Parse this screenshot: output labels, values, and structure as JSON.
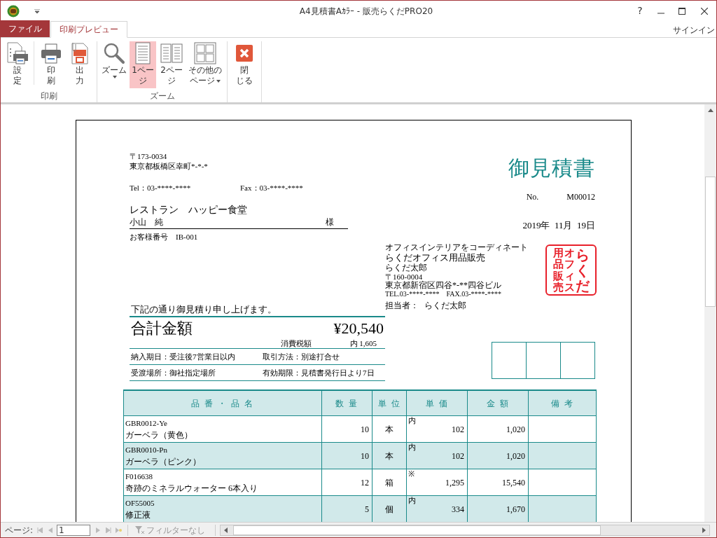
{
  "window": {
    "title": "A4見積書Aｶﾗｰ - 販売らくだPRO20",
    "help": "?"
  },
  "ribbon": {
    "file_menu": "ファイル",
    "tabs": [
      {
        "label": "印刷プレビュー",
        "selected": true
      }
    ],
    "account": "サインイン",
    "groups": [
      {
        "label": "印刷",
        "buttons": [
          {
            "kind": "setup",
            "lines": [
              "設",
              "定"
            ],
            "dropdown": false,
            "selected": false
          },
          {
            "kind": "printer",
            "lines": [
              "印",
              "刷"
            ],
            "dropdown": false,
            "selected": false
          },
          {
            "kind": "pdf",
            "lines": [
              "出",
              "力"
            ],
            "dropdown": false,
            "selected": false
          }
        ]
      },
      {
        "label": "ズーム",
        "buttons": [
          {
            "kind": "zoom",
            "lines": [
              "ズーム"
            ],
            "dropdown": true,
            "selected": false
          },
          {
            "kind": "one-page",
            "lines": [
              "1ペー",
              "ジ"
            ],
            "dropdown": false,
            "selected": true
          },
          {
            "kind": "two-page",
            "lines": [
              "2ペー",
              "ジ"
            ],
            "dropdown": false,
            "selected": false
          },
          {
            "kind": "multi-page",
            "lines": [
              "その他の",
              "ページ"
            ],
            "dropdown": true,
            "selected": false
          }
        ]
      },
      {
        "buttons": [
          {
            "kind": "close",
            "lines": [
              "閉",
              "じる"
            ],
            "dropdown": false,
            "selected": false
          }
        ]
      }
    ]
  },
  "document": {
    "customer": {
      "postal": "〒173-0034",
      "address": "東京都板橋区幸町*-*-*",
      "tel": "Tel：03-****-****",
      "fax": "Fax：03-****-****",
      "company": "レストラン　ハッピー食堂",
      "person": "小山　純",
      "honorific": "様",
      "number": "お客様番号　IB-001"
    },
    "title": "御見積書",
    "no_label": "No.",
    "no": "M00012",
    "date": "2019年  11月  19日",
    "issuer": {
      "tagline": "オフィスインテリアをコーディネート",
      "company": "らくだオフィス用品販売",
      "person": "らくだ太郎",
      "postal": "〒160-0004",
      "address": "東京都新宿区四谷*-**四谷ビル",
      "tel": "TEL.03-****-****",
      "fax": "FAX.03-****-****",
      "staff_label": "担当者：",
      "staff": "らくだ太郎",
      "stamp": [
        "用品販売",
        "オフィス",
        "らくだ"
      ]
    },
    "intro": "下記の通り御見積り申し上げます。",
    "total_label": "合計金額",
    "total": "¥20,540",
    "tax_label": "消費税額",
    "tax": "内 1,605",
    "terms": [
      {
        "left": "納入期日：受注後7営業日以内",
        "right": "取引方法：別途打合せ"
      },
      {
        "left": "受渡場所：御社指定場所",
        "right": "有効期限：見積書発行日より7日"
      }
    ],
    "table": {
      "columns": [
        "品 番 ・ 品 名",
        "数 量",
        "単 位",
        "単 価",
        "金 額",
        "備 考"
      ],
      "rows": [
        {
          "code": "GBR0012-Ye",
          "name": "ガーベラ（黄色）",
          "qty": "10",
          "unit": "本",
          "tax_mark": "内",
          "price": "102",
          "amount": "1,020"
        },
        {
          "code": "GBR0010-Pn",
          "name": "ガーベラ（ピンク）",
          "qty": "10",
          "unit": "本",
          "tax_mark": "内",
          "price": "102",
          "amount": "1,020"
        },
        {
          "code": "F016638",
          "name": "奇跡のミネラルウォーター 6本入り",
          "qty": "12",
          "unit": "箱",
          "tax_mark": "※",
          "price": "1,295",
          "amount": "15,540"
        },
        {
          "code": "OF55005",
          "name": "修正液",
          "qty": "5",
          "unit": "個",
          "tax_mark": "内",
          "price": "334",
          "amount": "1,670"
        }
      ]
    }
  },
  "status": {
    "page_label": "ページ:",
    "page": "1",
    "filter": "フィルターなし"
  }
}
